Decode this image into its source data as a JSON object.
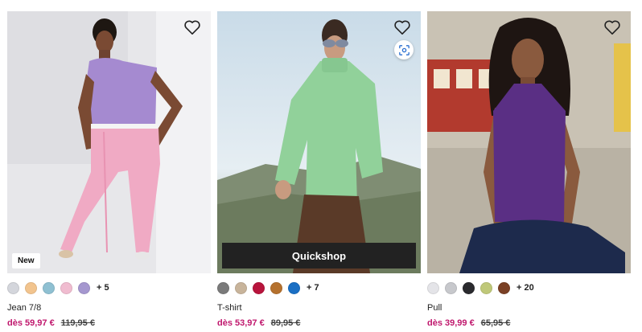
{
  "colors": {
    "accent_price": "#c0176d",
    "quickshop_bg": "#222222"
  },
  "products": [
    {
      "name": "Jean 7/8",
      "price": "dès 59,97 €",
      "old_price": "119,95 €",
      "badge": "New",
      "swatches": [
        "#d4d6dc",
        "#f2c48e",
        "#8fc0d2",
        "#f0bcd0",
        "#a597cf"
      ],
      "more": "+ 5"
    },
    {
      "name": "T-shirt",
      "price": "dès 53,97 €",
      "old_price": "89,95 €",
      "quickshop_label": "Quickshop",
      "swatches": [
        "#7a7a7a",
        "#c8b49b",
        "#b8143c",
        "#b5712e",
        "#1a6fc4"
      ],
      "more": "+ 7"
    },
    {
      "name": "Pull",
      "price": "dès 39,99 €",
      "old_price": "65,95 €",
      "swatches": [
        "#e4e4e8",
        "#c7c8cc",
        "#2a2a2e",
        "#bfc879",
        "#7a4025"
      ],
      "more": "+ 20"
    }
  ],
  "icons": {
    "wishlist": "heart-outline-icon",
    "visual_search": "visual-search-icon"
  }
}
